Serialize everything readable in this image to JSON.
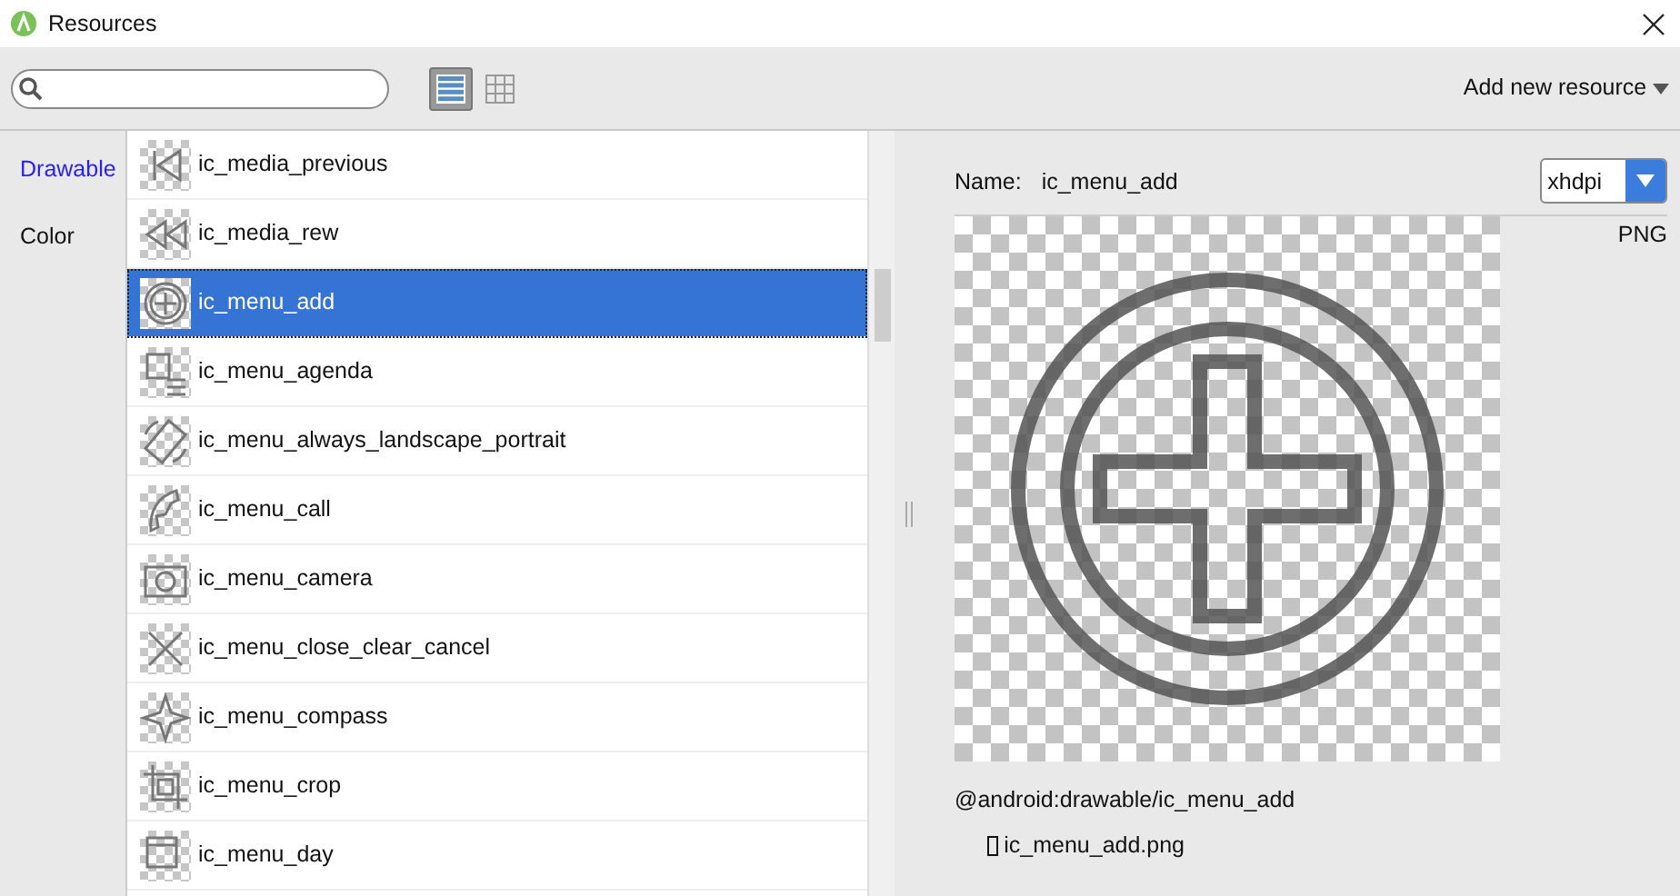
{
  "window": {
    "title": "Resources"
  },
  "toolbar": {
    "view_modes": [
      {
        "kind": "list",
        "selected": true
      },
      {
        "kind": "grid",
        "selected": false
      }
    ],
    "add_button": "Add new resource"
  },
  "categories": [
    {
      "label": "Drawable",
      "selected": true
    },
    {
      "label": "Color",
      "selected": false
    }
  ],
  "resources": [
    {
      "name": "ic_media_previous",
      "selected": false
    },
    {
      "name": "ic_media_rew",
      "selected": false
    },
    {
      "name": "ic_menu_add",
      "selected": true
    },
    {
      "name": "ic_menu_agenda",
      "selected": false
    },
    {
      "name": "ic_menu_always_landscape_portrait",
      "selected": false
    },
    {
      "name": "ic_menu_call",
      "selected": false
    },
    {
      "name": "ic_menu_camera",
      "selected": false
    },
    {
      "name": "ic_menu_close_clear_cancel",
      "selected": false
    },
    {
      "name": "ic_menu_compass",
      "selected": false
    },
    {
      "name": "ic_menu_crop",
      "selected": false
    },
    {
      "name": "ic_menu_day",
      "selected": false
    }
  ],
  "details": {
    "name_label": "Name:",
    "name": "ic_menu_add",
    "density": "xhdpi",
    "format": "PNG",
    "reference": "@android:drawable/ic_menu_add",
    "file": "ic_menu_add.png"
  }
}
